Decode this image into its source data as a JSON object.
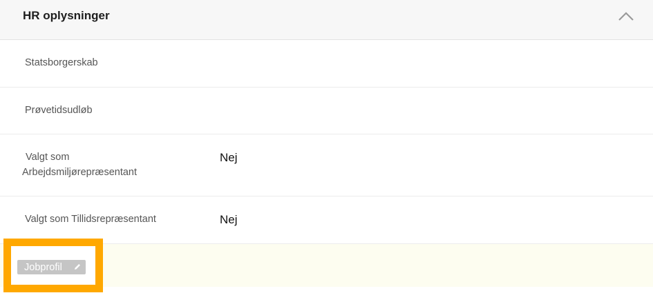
{
  "section": {
    "title": "HR oplysninger",
    "toggle_icon": "chevron-up-icon"
  },
  "fields": [
    {
      "label": "Statsborgerskab",
      "value": ""
    },
    {
      "label": "Prøvetidsudløb",
      "value": ""
    },
    {
      "label_line1": "Valgt som",
      "label_line2": "Arbejdsmiljørepræsentant",
      "value": "Nej"
    },
    {
      "label": "Valgt som Tillidsrepræsentant",
      "value": "Nej"
    }
  ],
  "jobprofile": {
    "label": "Jobprofil",
    "icon": "pencil-icon"
  },
  "colors": {
    "highlight_frame": "#ffa800",
    "tag_background": "#c5c5c5",
    "header_background": "#f7f7f7",
    "section_background": "#fdfdf0"
  }
}
